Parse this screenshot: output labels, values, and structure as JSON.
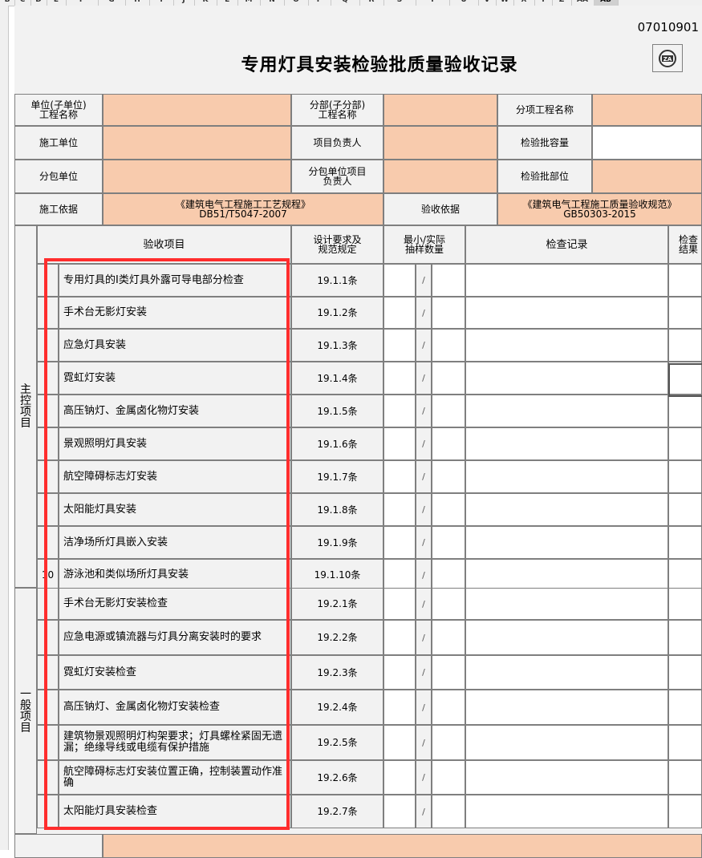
{
  "column_headers": [
    "B",
    "C",
    "D",
    "E",
    "F",
    "G",
    "H",
    "I",
    "J",
    "K",
    "L",
    "M",
    "N",
    "O",
    "P",
    "Q",
    "R",
    "S",
    "T",
    "U",
    "V",
    "W",
    "X",
    "Y",
    "Z",
    "AA",
    "AB"
  ],
  "selected_column": "AB",
  "form_code": "07010901",
  "logo_text": "ZA",
  "title": "专用灯具安装检验批质量验收记录",
  "header": {
    "unit_label": "单位(子单位)\n工程名称",
    "subdiv_label": "分部(子分部)\n工程名称",
    "subitem_label": "分项工程名称",
    "contractor_label": "施工单位",
    "project_lead_label": "项目负责人",
    "batch_capacity_label": "检验批容量",
    "subcontractor_label": "分包单位",
    "subcontractor_lead_label": "分包单位项目\n负责人",
    "batch_location_label": "检验批部位",
    "basis_label": "施工依据",
    "basis_value": "《建筑电气工程施工工艺规程》\nDB51/T5047-2007",
    "acceptance_basis_label": "验收依据",
    "acceptance_basis_value": "《建筑电气工程施工质量验收规范》\nGB50303-2015"
  },
  "table_headers": {
    "item": "验收项目",
    "design": "设计要求及\n规范规定",
    "sample": "最小/实际\n抽样数量",
    "record": "检查记录",
    "result": "检查\n结果"
  },
  "main_group_label": "主控项目",
  "general_group_label": "一般项目",
  "slash": "/",
  "main_items": [
    {
      "no": "",
      "name": "专用灯具的Ⅰ类灯具外露可导电部分检查",
      "clause": "19.1.1条"
    },
    {
      "no": "",
      "name": "手术台无影灯安装",
      "clause": "19.1.2条"
    },
    {
      "no": "",
      "name": "应急灯具安装",
      "clause": "19.1.3条"
    },
    {
      "no": "",
      "name": "霓虹灯安装",
      "clause": "19.1.4条"
    },
    {
      "no": "",
      "name": "高压钠灯、金属卤化物灯安装",
      "clause": "19.1.5条"
    },
    {
      "no": "",
      "name": "景观照明灯具安装",
      "clause": "19.1.6条"
    },
    {
      "no": "",
      "name": "航空障碍标志灯安装",
      "clause": "19.1.7条"
    },
    {
      "no": "",
      "name": "太阳能灯具安装",
      "clause": "19.1.8条"
    },
    {
      "no": "",
      "name": "洁净场所灯具嵌入安装",
      "clause": "19.1.9条"
    },
    {
      "no": "10",
      "name": "游泳池和类似场所灯具安装",
      "clause": "19.1.10条"
    }
  ],
  "general_items": [
    {
      "no": "",
      "name": "手术台无影灯安装检查",
      "clause": "19.2.1条"
    },
    {
      "no": "",
      "name": "应急电源或镇流器与灯具分离安装时的要求",
      "clause": "19.2.2条"
    },
    {
      "no": "",
      "name": "霓虹灯安装检查",
      "clause": "19.2.3条"
    },
    {
      "no": "",
      "name": "高压钠灯、金属卤化物灯安装检查",
      "clause": "19.2.4条"
    },
    {
      "no": "",
      "name": "建筑物景观照明灯构架要求；灯具螺栓紧固无遗漏；绝缘导线或电缆有保护措施",
      "clause": "19.2.5条"
    },
    {
      "no": "",
      "name": "航空障碍标志灯安装位置正确，控制装置动作准确",
      "clause": "19.2.6条"
    },
    {
      "no": "",
      "name": "太阳能灯具安装检查",
      "clause": "19.2.7条"
    }
  ]
}
